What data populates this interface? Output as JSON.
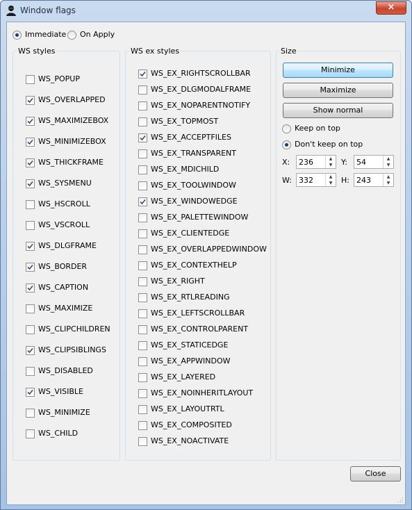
{
  "window": {
    "title": "Window flags",
    "close_glyph": "×"
  },
  "mode": {
    "immediate": {
      "label": "Immediate",
      "checked": true
    },
    "on_apply": {
      "label": "On Apply",
      "checked": false
    }
  },
  "ws_styles": {
    "title": "WS styles",
    "items": [
      {
        "label": "WS_POPUP",
        "checked": false
      },
      {
        "label": "WS_OVERLAPPED",
        "checked": true
      },
      {
        "label": "WS_MAXIMIZEBOX",
        "checked": true
      },
      {
        "label": "WS_MINIMIZEBOX",
        "checked": true
      },
      {
        "label": "WS_THICKFRAME",
        "checked": true
      },
      {
        "label": "WS_SYSMENU",
        "checked": true
      },
      {
        "label": "WS_HSCROLL",
        "checked": false
      },
      {
        "label": "WS_VSCROLL",
        "checked": false
      },
      {
        "label": "WS_DLGFRAME",
        "checked": true
      },
      {
        "label": "WS_BORDER",
        "checked": true
      },
      {
        "label": "WS_CAPTION",
        "checked": true
      },
      {
        "label": "WS_MAXIMIZE",
        "checked": false
      },
      {
        "label": "WS_CLIPCHILDREN",
        "checked": false
      },
      {
        "label": "WS_CLIPSIBLINGS",
        "checked": true
      },
      {
        "label": "WS_DISABLED",
        "checked": false
      },
      {
        "label": "WS_VISIBLE",
        "checked": true
      },
      {
        "label": "WS_MINIMIZE",
        "checked": false
      },
      {
        "label": "WS_CHILD",
        "checked": false
      }
    ]
  },
  "ws_ex_styles": {
    "title": "WS ex styles",
    "items": [
      {
        "label": "WS_EX_RIGHTSCROLLBAR",
        "checked": true
      },
      {
        "label": "WS_EX_DLGMODALFRAME",
        "checked": false
      },
      {
        "label": "WS_EX_NOPARENTNOTIFY",
        "checked": false
      },
      {
        "label": "WS_EX_TOPMOST",
        "checked": false
      },
      {
        "label": "WS_EX_ACCEPTFILES",
        "checked": true
      },
      {
        "label": "WS_EX_TRANSPARENT",
        "checked": false
      },
      {
        "label": "WS_EX_MDICHILD",
        "checked": false
      },
      {
        "label": "WS_EX_TOOLWINDOW",
        "checked": false
      },
      {
        "label": "WS_EX_WINDOWEDGE",
        "checked": true
      },
      {
        "label": "WS_EX_PALETTEWINDOW",
        "checked": false
      },
      {
        "label": "WS_EX_CLIENTEDGE",
        "checked": false
      },
      {
        "label": "WS_EX_OVERLAPPEDWINDOW",
        "checked": false
      },
      {
        "label": "WS_EX_CONTEXTHELP",
        "checked": false
      },
      {
        "label": "WS_EX_RIGHT",
        "checked": false
      },
      {
        "label": "WS_EX_RTLREADING",
        "checked": false
      },
      {
        "label": "WS_EX_LEFTSCROLLBAR",
        "checked": false
      },
      {
        "label": "WS_EX_CONTROLPARENT",
        "checked": false
      },
      {
        "label": "WS_EX_STATICEDGE",
        "checked": false
      },
      {
        "label": "WS_EX_APPWINDOW",
        "checked": false
      },
      {
        "label": "WS_EX_LAYERED",
        "checked": false
      },
      {
        "label": "WS_EX_NOINHERITLAYOUT",
        "checked": false
      },
      {
        "label": "WS_EX_LAYOUTRTL",
        "checked": false
      },
      {
        "label": "WS_EX_COMPOSITED",
        "checked": false
      },
      {
        "label": "WS_EX_NOACTIVATE",
        "checked": false
      }
    ]
  },
  "size": {
    "title": "Size",
    "minimize_label": "Minimize",
    "maximize_label": "Maximize",
    "show_normal_label": "Show normal",
    "keep_on_top": {
      "label": "Keep on top",
      "checked": false
    },
    "dont_keep_on_top": {
      "label": "Don't keep on top",
      "checked": true
    },
    "x": {
      "label": "X:",
      "value": "236"
    },
    "y": {
      "label": "Y:",
      "value": "54"
    },
    "w": {
      "label": "W:",
      "value": "332"
    },
    "h": {
      "label": "H:",
      "value": "243"
    }
  },
  "footer": {
    "close_label": "Close"
  },
  "colors": {
    "check": "#3a4f73",
    "radio_dot": "#1b3b7c",
    "titlebar": "#b9cfe9"
  }
}
